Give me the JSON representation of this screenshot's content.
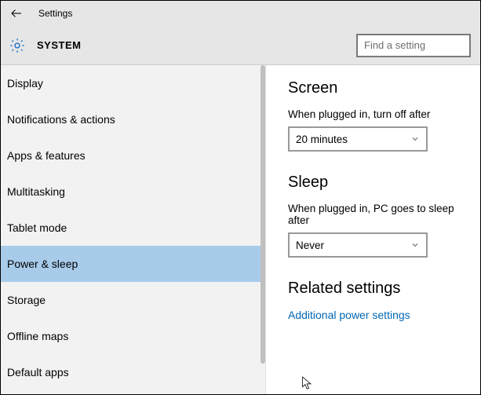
{
  "header": {
    "app_title": "Settings",
    "section": "SYSTEM",
    "search_placeholder": "Find a setting"
  },
  "sidebar": {
    "items": [
      {
        "label": "Display",
        "selected": false
      },
      {
        "label": "Notifications & actions",
        "selected": false
      },
      {
        "label": "Apps & features",
        "selected": false
      },
      {
        "label": "Multitasking",
        "selected": false
      },
      {
        "label": "Tablet mode",
        "selected": false
      },
      {
        "label": "Power & sleep",
        "selected": true
      },
      {
        "label": "Storage",
        "selected": false
      },
      {
        "label": "Offline maps",
        "selected": false
      },
      {
        "label": "Default apps",
        "selected": false
      }
    ]
  },
  "main": {
    "screen": {
      "heading": "Screen",
      "label": "When plugged in, turn off after",
      "value": "20 minutes"
    },
    "sleep": {
      "heading": "Sleep",
      "label": "When plugged in, PC goes to sleep after",
      "value": "Never"
    },
    "related": {
      "heading": "Related settings",
      "link": "Additional power settings"
    }
  }
}
